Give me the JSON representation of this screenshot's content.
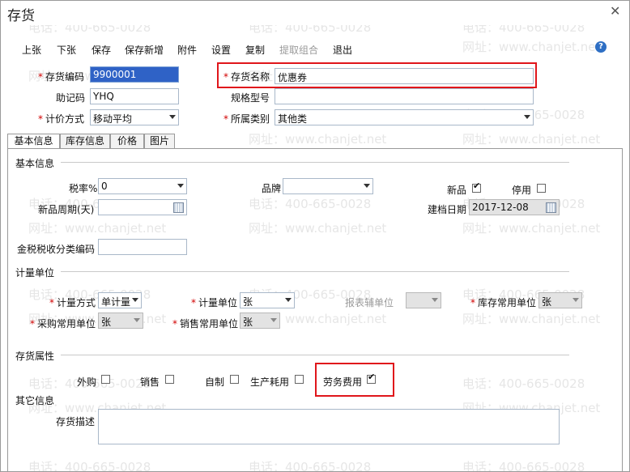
{
  "window": {
    "title": "存货"
  },
  "watermark": {
    "phone": "电话：400-665-0028",
    "site": "网址：www.chanjet.net"
  },
  "toolbar": {
    "items": [
      "上张",
      "下张",
      "保存",
      "保存新增",
      "附件",
      "设置",
      "复制",
      "提取组合",
      "退出"
    ],
    "help_icon": "?"
  },
  "header_fields": {
    "code": {
      "label": "存货编码",
      "value": "9900001"
    },
    "name": {
      "label": "存货名称",
      "value": "优惠券"
    },
    "mnemonic": {
      "label": "助记码",
      "value": "YHQ"
    },
    "spec": {
      "label": "规格型号",
      "value": ""
    },
    "valuation": {
      "label": "计价方式",
      "value": "移动平均"
    },
    "category": {
      "label": "所属类别",
      "value": "其他类"
    }
  },
  "tabs": [
    "基本信息",
    "库存信息",
    "价格",
    "图片"
  ],
  "basic": {
    "section_title": "基本信息",
    "tax_rate": {
      "label": "税率%",
      "value": "0"
    },
    "brand": {
      "label": "品牌",
      "value": ""
    },
    "new_product": {
      "label": "新品",
      "checked": true
    },
    "disabled": {
      "label": "停用",
      "checked": false
    },
    "new_cycle": {
      "label": "新品周期(天)",
      "value": ""
    },
    "create_date": {
      "label": "建档日期",
      "value": "2017-12-08"
    },
    "tax_code": {
      "label": "金税税收分类编码",
      "value": ""
    }
  },
  "unit": {
    "section_title": "计量单位",
    "measure_method": {
      "label": "计量方式",
      "value": "单计量"
    },
    "measure_unit": {
      "label": "计量单位",
      "value": "张"
    },
    "report_aux": {
      "label": "报表辅单位",
      "value": ""
    },
    "stock_unit": {
      "label": "库存常用单位",
      "value": "张"
    },
    "purchase_unit": {
      "label": "采购常用单位",
      "value": "张"
    },
    "sales_unit": {
      "label": "销售常用单位",
      "value": "张"
    }
  },
  "attrs": {
    "section_title": "存货属性",
    "items": [
      {
        "label": "外购",
        "checked": false
      },
      {
        "label": "销售",
        "checked": false
      },
      {
        "label": "自制",
        "checked": false
      },
      {
        "label": "生产耗用",
        "checked": false
      },
      {
        "label": "劳务费用",
        "checked": true
      }
    ]
  },
  "other": {
    "section_title": "其它信息",
    "desc": {
      "label": "存货描述",
      "value": ""
    }
  },
  "colors": {
    "required": "#d10000",
    "highlight_box": "#e0161b",
    "selection": "#2f62c6"
  }
}
